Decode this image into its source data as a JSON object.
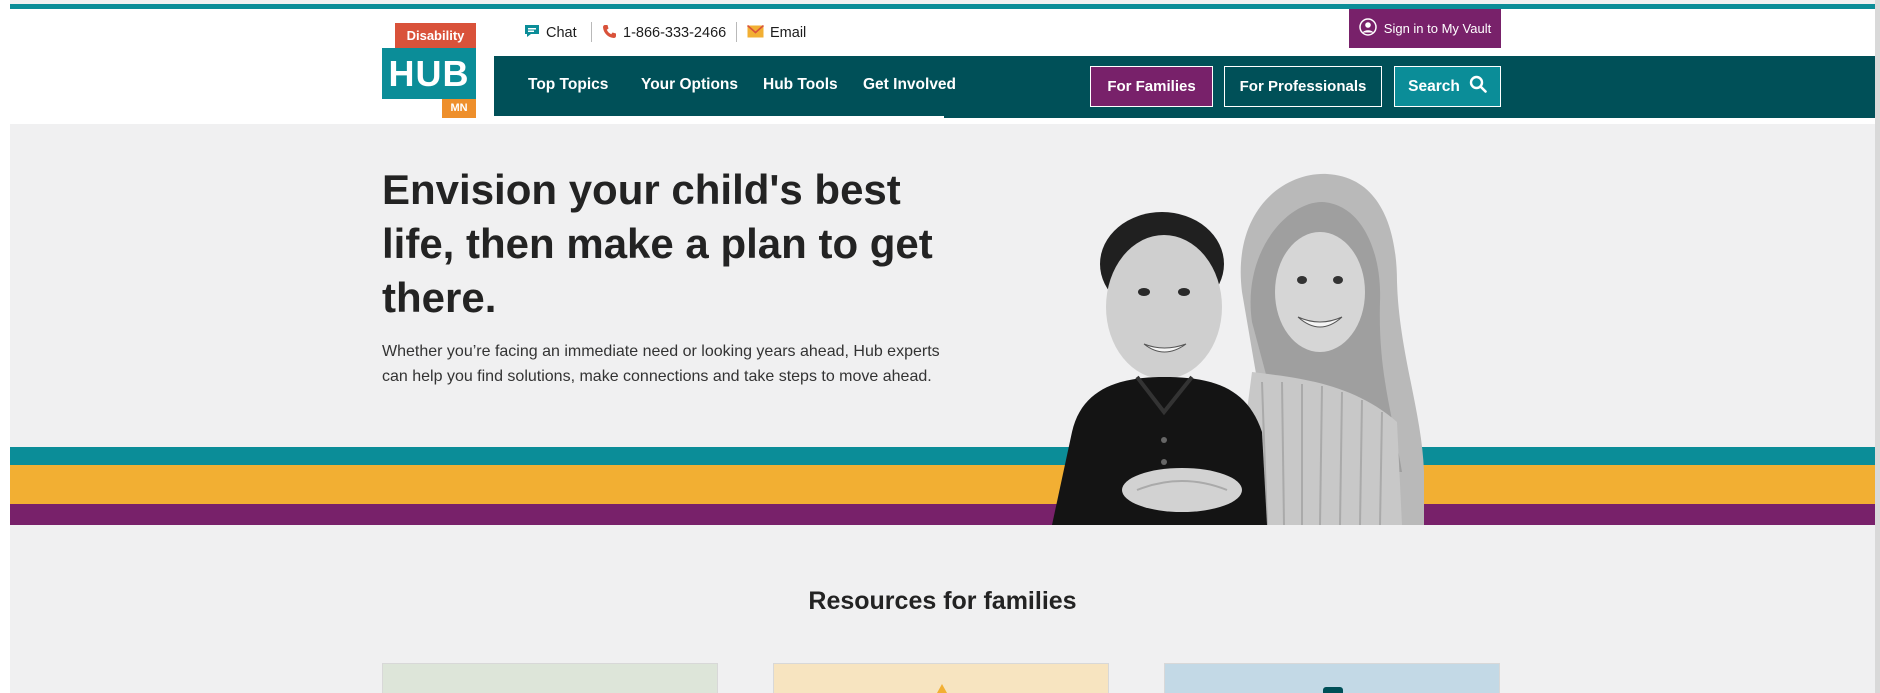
{
  "brand": {
    "logo_top": "Disability",
    "logo_main": "HUB",
    "logo_bottom": "MN"
  },
  "utility": {
    "chat_label": "Chat",
    "phone_label": "1-866-333-2466",
    "email_label": "Email",
    "vault_label": "Sign in to My Vault"
  },
  "nav": {
    "items": [
      {
        "label": "Top Topics"
      },
      {
        "label": "Your Options"
      },
      {
        "label": "Hub Tools"
      },
      {
        "label": "Get Involved"
      }
    ],
    "for_families": "For Families",
    "for_professionals": "For Professionals",
    "search_label": "Search"
  },
  "hero": {
    "title": "Envision your child's best life, then make a plan to get there.",
    "text": "Whether you’re facing an immediate need or looking years ahead, Hub experts can help you find solutions, make connections and take steps to move ahead."
  },
  "resources": {
    "title": "Resources for families"
  },
  "colors": {
    "teal": "#0b8d98",
    "dark_teal": "#005058",
    "purple": "#78216a",
    "gold": "#f2af33",
    "orange": "#ee8f2b",
    "red": "#d9523a"
  },
  "icons": {
    "chat": "chat-bubble-icon",
    "phone": "phone-icon",
    "email": "envelope-icon",
    "vault": "user-circle-icon",
    "search": "magnifier-icon"
  }
}
